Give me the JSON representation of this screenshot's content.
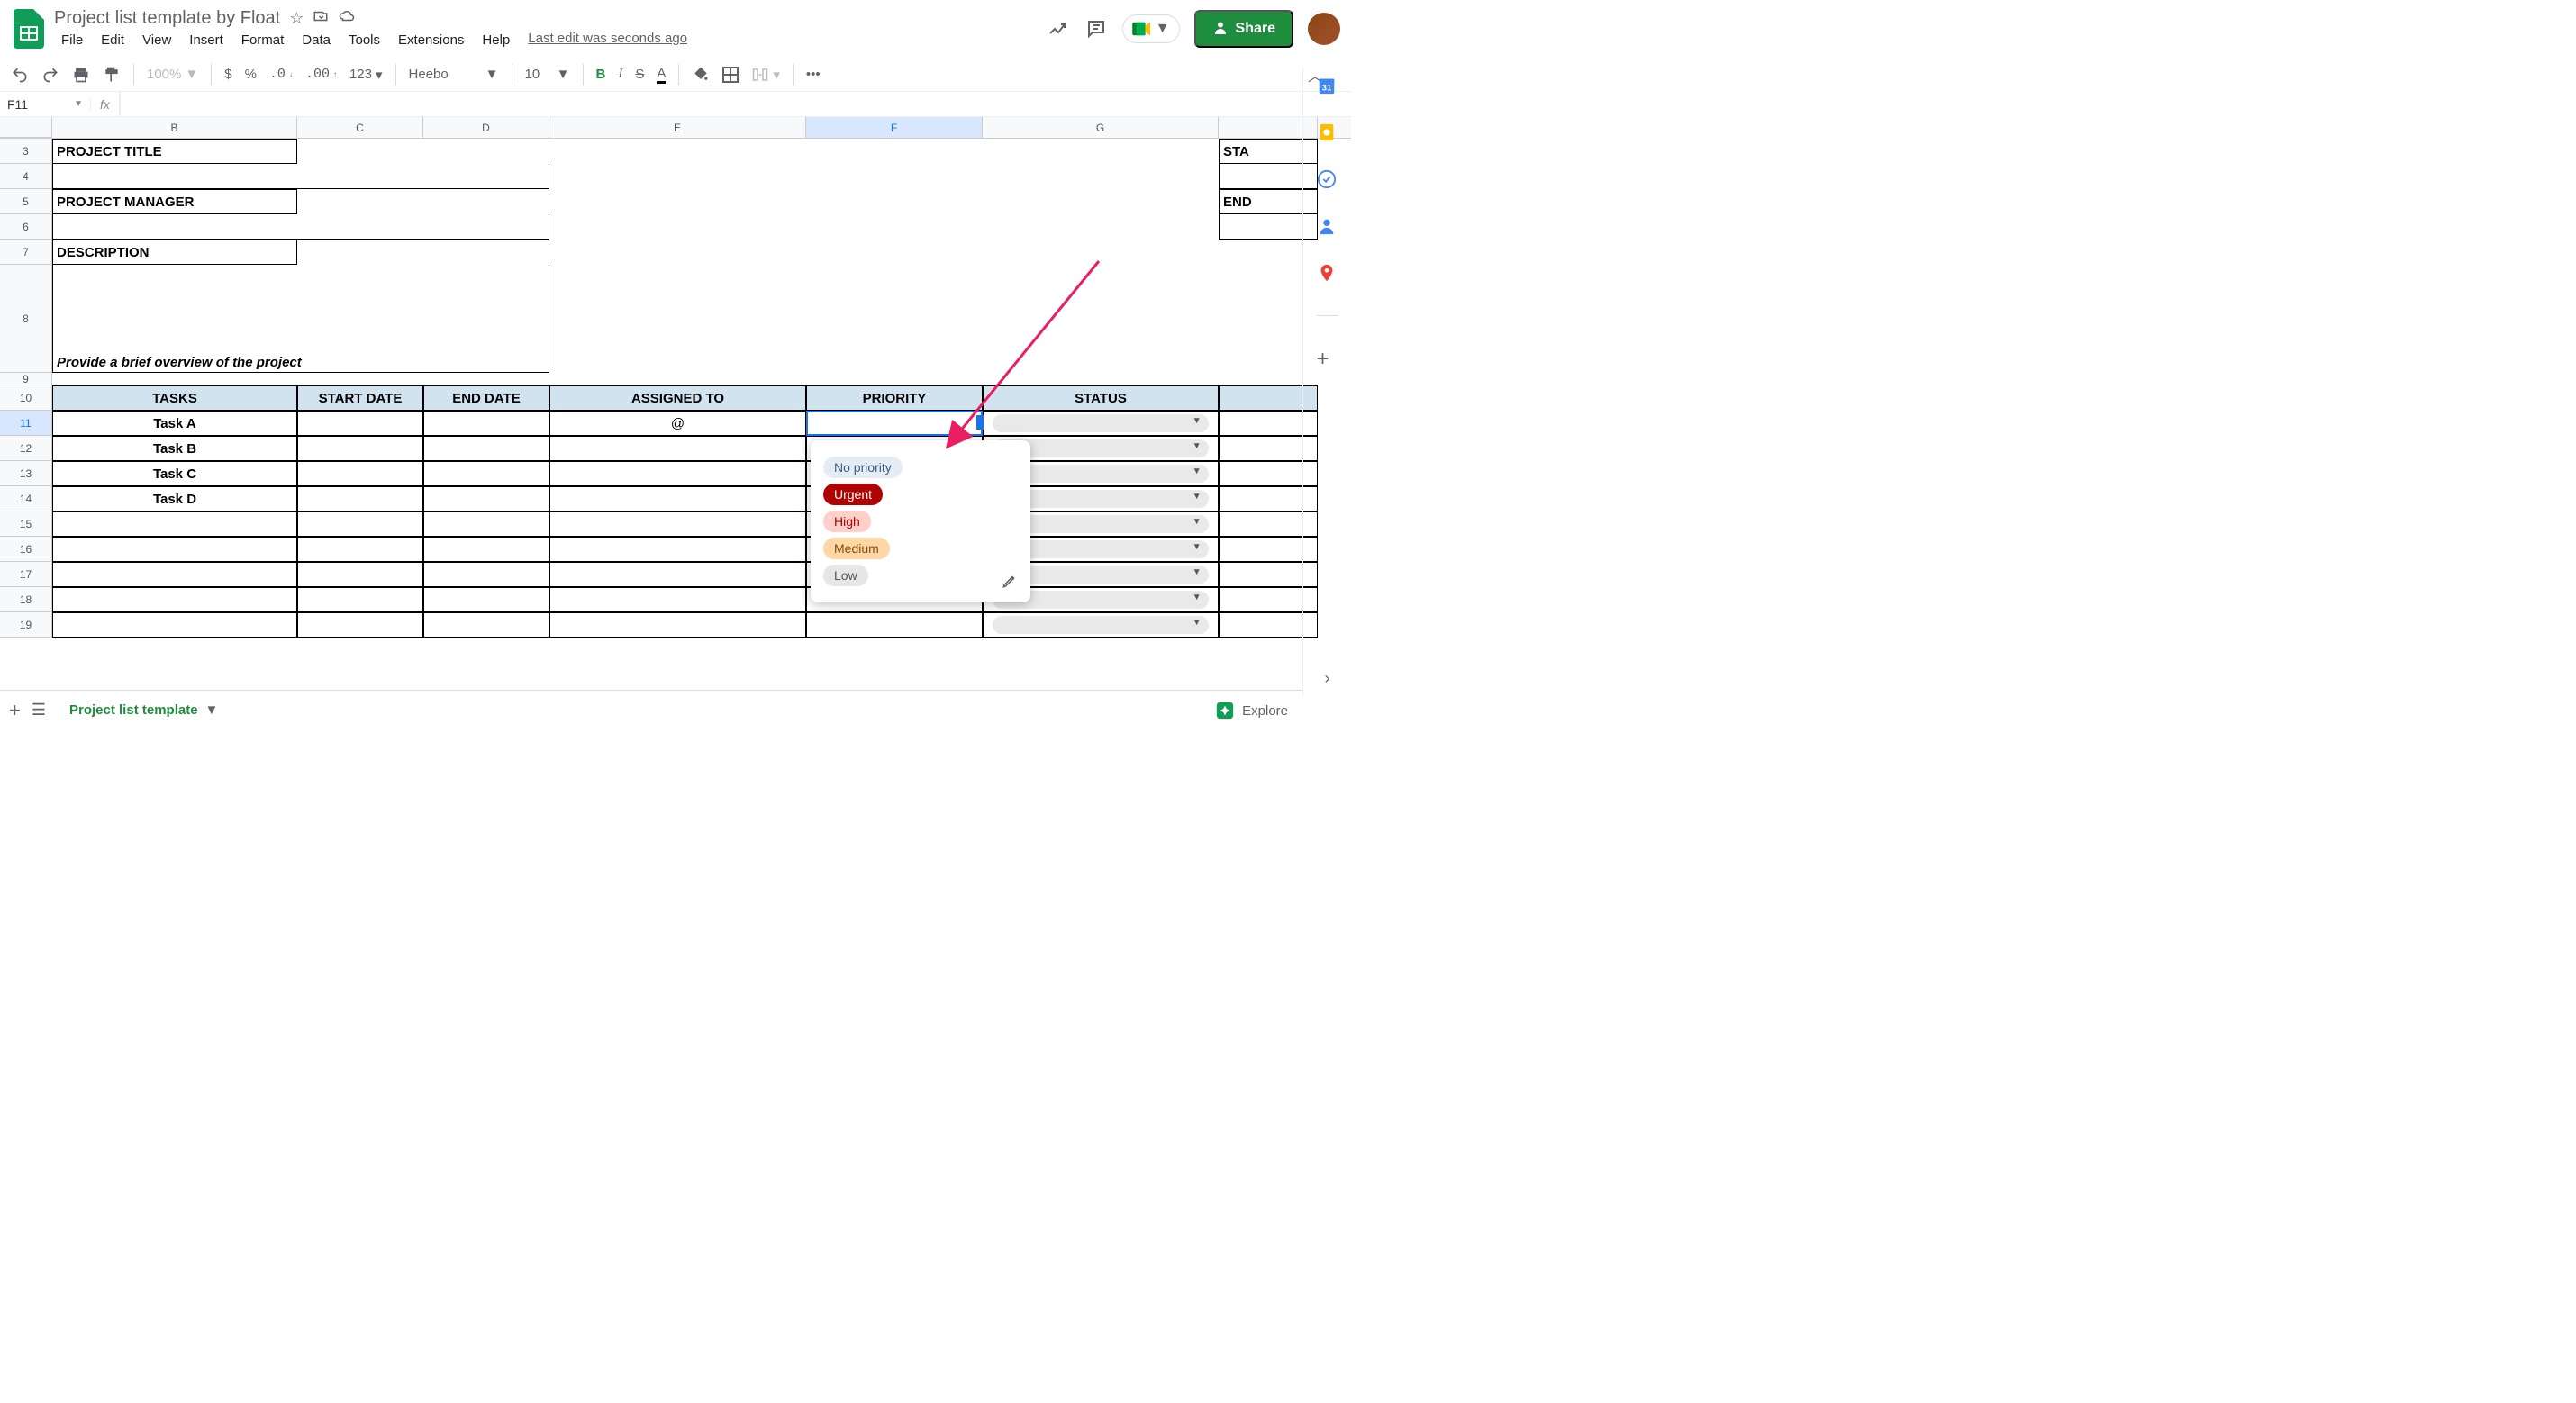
{
  "doc": {
    "title": "Project list template by Float",
    "last_edit": "Last edit was seconds ago"
  },
  "menu": {
    "file": "File",
    "edit": "Edit",
    "view": "View",
    "insert": "Insert",
    "format": "Format",
    "data": "Data",
    "tools": "Tools",
    "extensions": "Extensions",
    "help": "Help"
  },
  "share": {
    "label": "Share"
  },
  "toolbar": {
    "zoom": "100%",
    "currency": "$",
    "percent": "%",
    "decless": ".0",
    "decmore": ".00",
    "numfmt": "123",
    "font": "Heebo",
    "size": "10",
    "bold": "B",
    "italic": "I",
    "strike": "S",
    "underline": "A"
  },
  "fx": {
    "cellref": "F11",
    "fx": "fx"
  },
  "columns": {
    "B": "B",
    "C": "C",
    "D": "D",
    "E": "E",
    "F": "F",
    "G": "G",
    "H": ""
  },
  "rows": [
    "3",
    "4",
    "5",
    "6",
    "7",
    "8",
    "9",
    "10",
    "11",
    "12",
    "13",
    "14",
    "15",
    "16",
    "17",
    "18",
    "19"
  ],
  "labels": {
    "project_title": "PROJECT TITLE",
    "project_manager": "PROJECT MANAGER",
    "description": "DESCRIPTION",
    "description_hint": "Provide a brief overview of the project",
    "start_col": "STA",
    "end_col": "END"
  },
  "table_headers": {
    "tasks": "TASKS",
    "start": "START DATE",
    "end": "END DATE",
    "assigned": "ASSIGNED TO",
    "priority": "PRIORITY",
    "status": "STATUS"
  },
  "tasks": [
    {
      "name": "Task A",
      "assigned": "@"
    },
    {
      "name": "Task B",
      "assigned": ""
    },
    {
      "name": "Task C",
      "assigned": ""
    },
    {
      "name": "Task D",
      "assigned": ""
    }
  ],
  "priority_options": [
    "No priority",
    "Urgent",
    "High",
    "Medium",
    "Low"
  ],
  "sheet": {
    "name": "Project list template"
  },
  "explore": {
    "label": "Explore"
  }
}
